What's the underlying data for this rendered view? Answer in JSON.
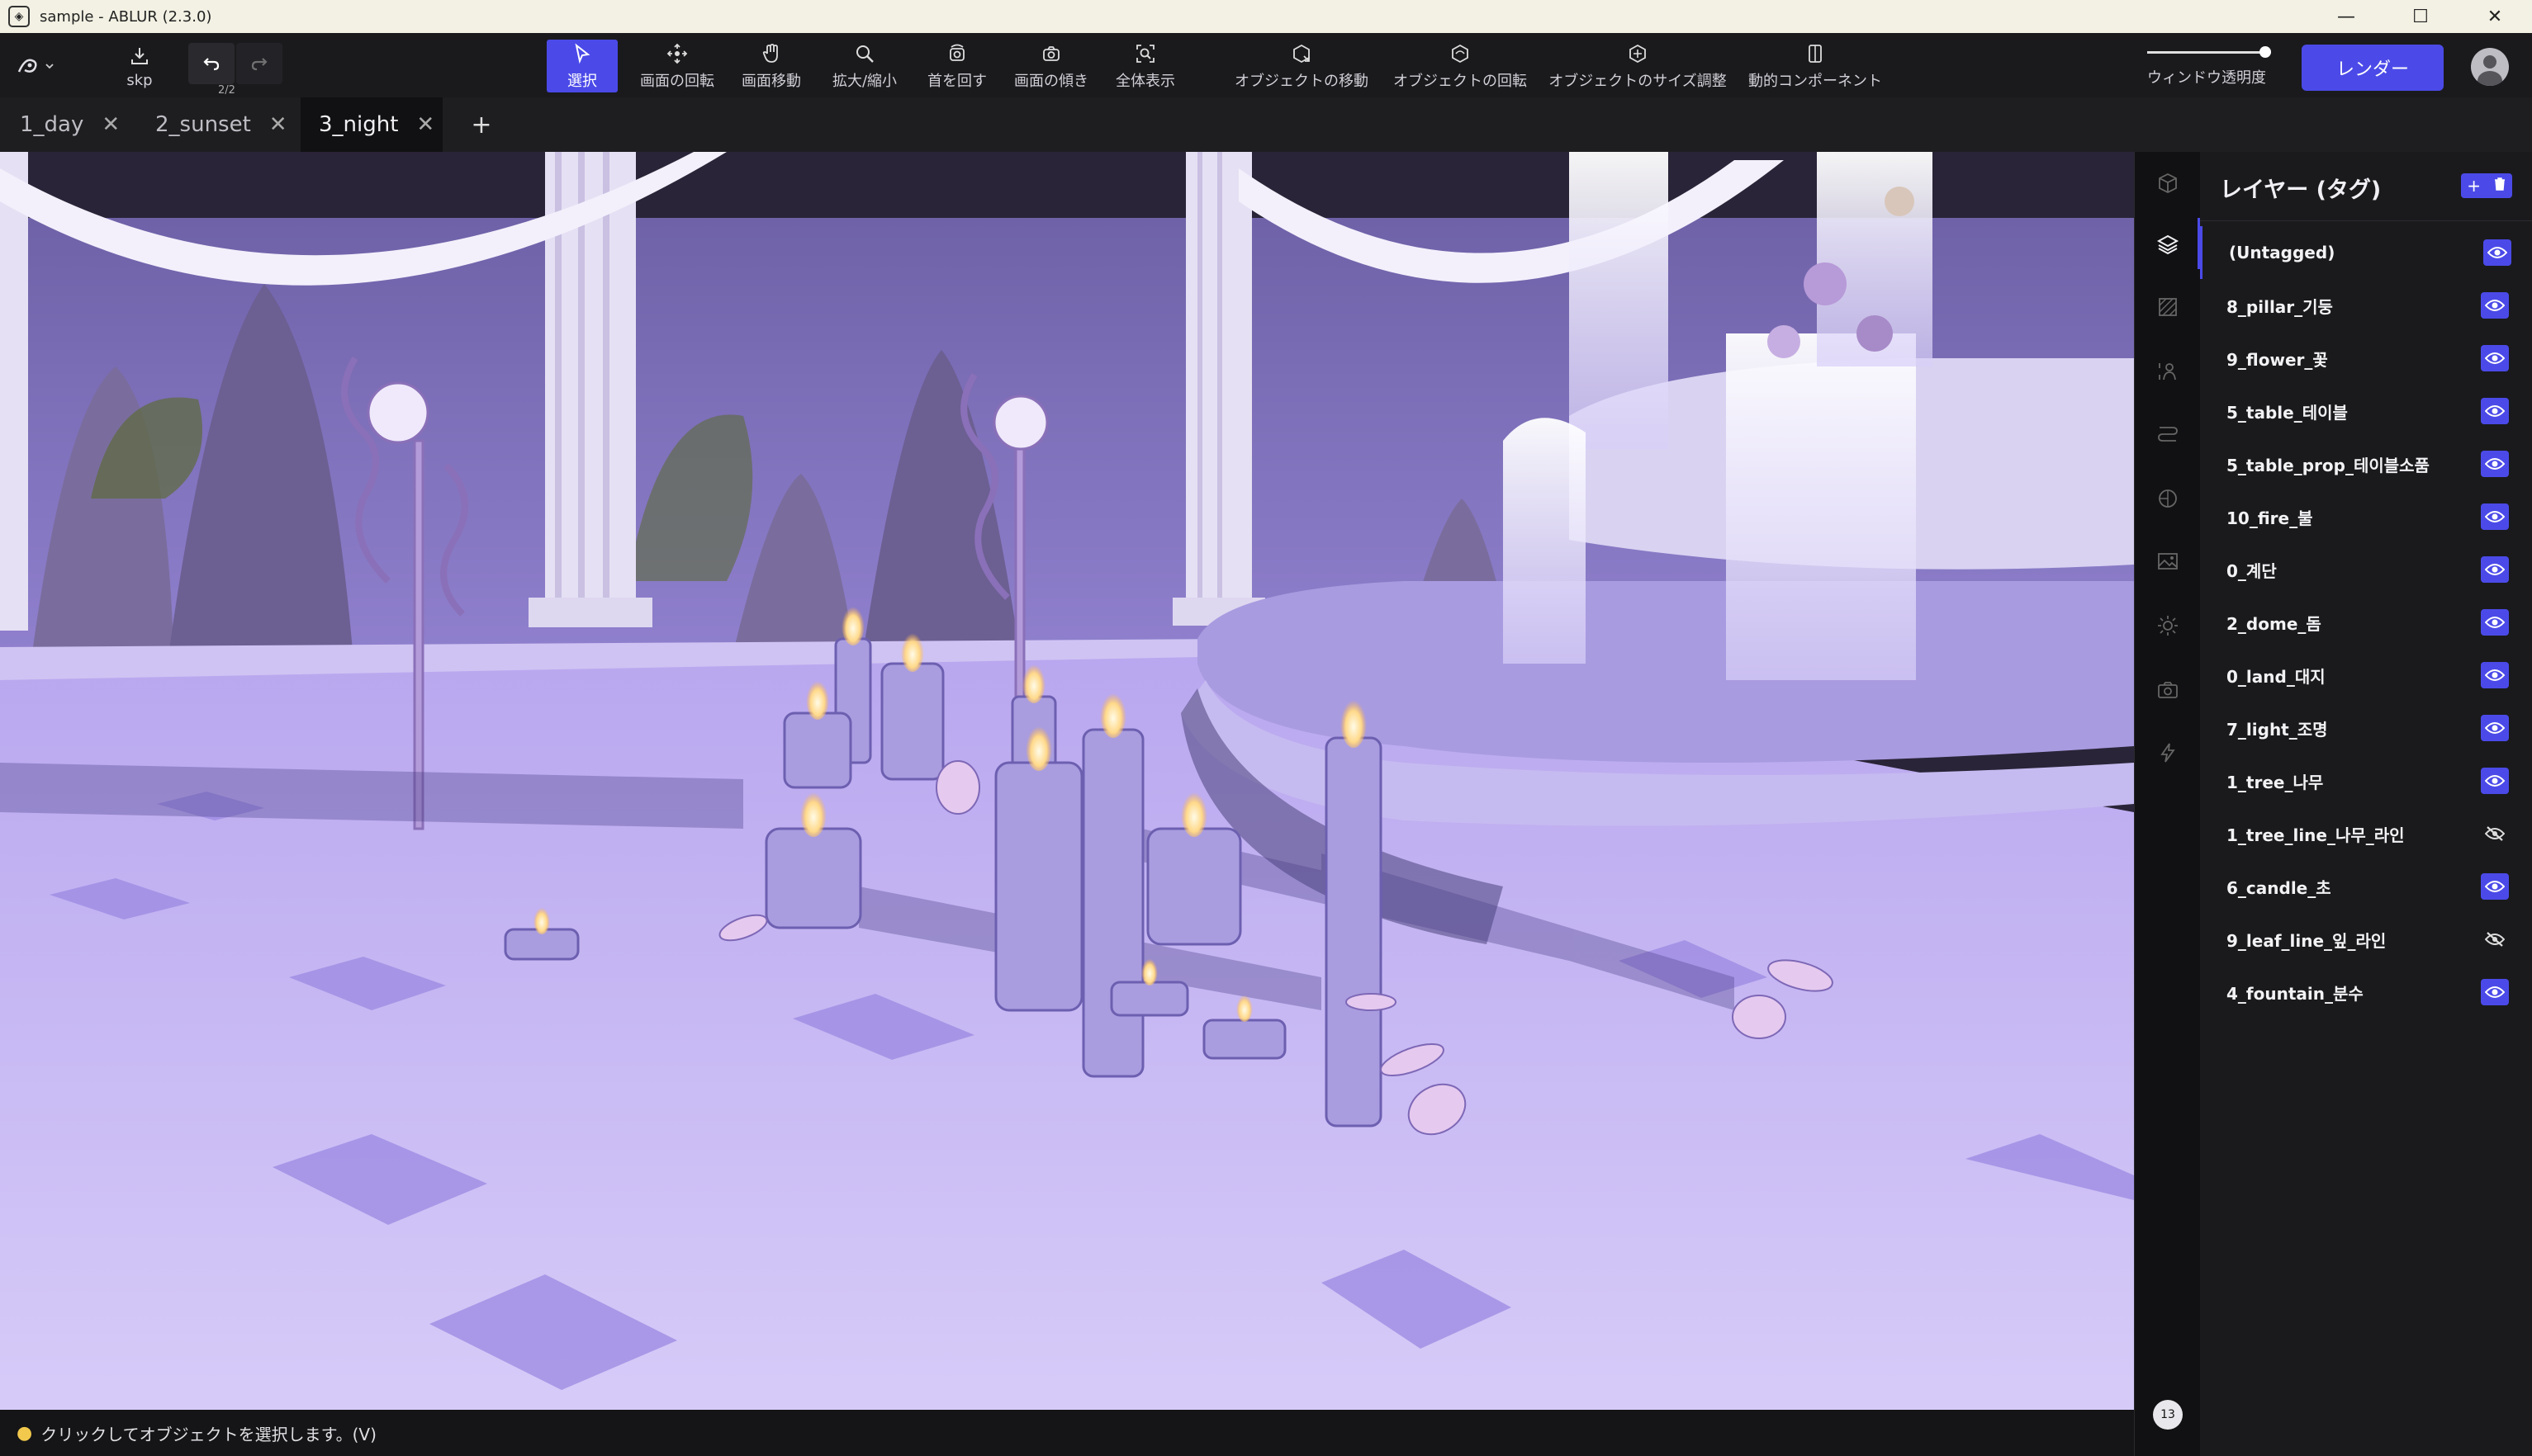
{
  "window": {
    "title": "sample - ABLUR (2.3.0)",
    "controls": [
      "minimize",
      "maximize",
      "close"
    ]
  },
  "toolbar": {
    "file_label": "skp",
    "undo_count": "2/2",
    "tools": [
      {
        "id": "select",
        "label": "選択",
        "icon": "cursor-icon",
        "active": true
      },
      {
        "id": "rotate-view",
        "label": "画面の回転",
        "icon": "orbit-icon",
        "active": false
      },
      {
        "id": "pan-view",
        "label": "画面移動",
        "icon": "hand-icon",
        "active": false
      },
      {
        "id": "zoom",
        "label": "拡大/縮小",
        "icon": "magnifier-icon",
        "active": false
      },
      {
        "id": "turn-head",
        "label": "首を回す",
        "icon": "head-turn-icon",
        "active": false
      },
      {
        "id": "tilt-view",
        "label": "画面の傾き",
        "icon": "camera-tilt-icon",
        "active": false
      },
      {
        "id": "fit-all",
        "label": "全体表示",
        "icon": "fit-view-icon",
        "active": false
      },
      {
        "id": "move-object",
        "label": "オブジェクトの移動",
        "icon": "move-object-icon",
        "active": false
      },
      {
        "id": "rotate-object",
        "label": "オブジェクトの回転",
        "icon": "rotate-object-icon",
        "active": false
      },
      {
        "id": "scale-object",
        "label": "オブジェクトのサイズ調整",
        "icon": "scale-object-icon",
        "active": false
      },
      {
        "id": "dynamic-component",
        "label": "動的コンポーネント",
        "icon": "component-icon",
        "active": false
      }
    ],
    "transparency_label": "ウィンドウ透明度",
    "transparency_value": 0.95,
    "render_label": "レンダー"
  },
  "tabs": [
    {
      "label": "1_day",
      "active": false
    },
    {
      "label": "2_sunset",
      "active": false
    },
    {
      "label": "3_night",
      "active": true
    }
  ],
  "status": {
    "hint": "クリックしてオブジェクトを選択します。(V)"
  },
  "rail": {
    "items": [
      "cube-icon",
      "layers-icon",
      "material-icon",
      "person-icon",
      "path-icon",
      "sphere-icon",
      "image-icon",
      "sun-icon",
      "camera-icon",
      "lightning-icon"
    ],
    "active": "layers-icon",
    "chat_badge": "13"
  },
  "layers_panel": {
    "title": "レイヤー (タグ)",
    "layers": [
      {
        "name": "(Untagged)",
        "visible": true
      },
      {
        "name": "8_pillar_기둥",
        "visible": true
      },
      {
        "name": "9_flower_꽃",
        "visible": true
      },
      {
        "name": "5_table_테이블",
        "visible": true
      },
      {
        "name": "5_table_prop_테이블소품",
        "visible": true
      },
      {
        "name": "10_fire_불",
        "visible": true
      },
      {
        "name": "0_계단",
        "visible": true
      },
      {
        "name": "2_dome_돔",
        "visible": true
      },
      {
        "name": "0_land_대지",
        "visible": true
      },
      {
        "name": "7_light_조명",
        "visible": true
      },
      {
        "name": "1_tree_나무",
        "visible": true
      },
      {
        "name": "1_tree_line_나무_라인",
        "visible": false
      },
      {
        "name": "6_candle_초",
        "visible": true
      },
      {
        "name": "9_leaf_line_잎_라인",
        "visible": false
      },
      {
        "name": "4_fountain_분수",
        "visible": true
      }
    ]
  },
  "colors": {
    "accent": "#4b4ae8",
    "viewport_floor": "#c9baf3",
    "viewport_wall": "#8a79c9"
  }
}
